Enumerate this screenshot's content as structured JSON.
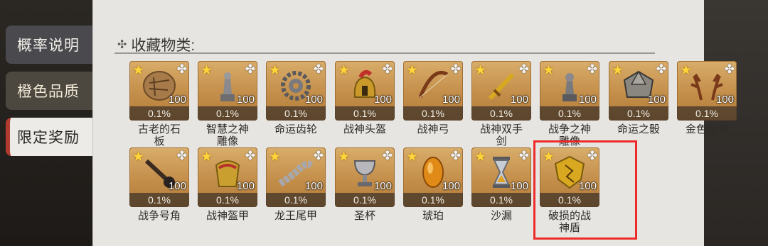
{
  "side_tabs": [
    {
      "label": "概率说明"
    },
    {
      "label": "橙色品质"
    },
    {
      "label": "限定奖励"
    }
  ],
  "section": {
    "deco": "✣",
    "title": "收藏物类:"
  },
  "items": [
    {
      "name": "古老的石板",
      "prob": "0.1%",
      "count": "100",
      "icon": "stone-tablet-icon"
    },
    {
      "name": "智慧之神雕像",
      "prob": "0.1%",
      "count": "100",
      "icon": "wisdom-statue-icon"
    },
    {
      "name": "命运齿轮",
      "prob": "0.1%",
      "count": "100",
      "icon": "gear-icon"
    },
    {
      "name": "战神头盔",
      "prob": "0.1%",
      "count": "100",
      "icon": "helmet-icon"
    },
    {
      "name": "战神弓",
      "prob": "0.1%",
      "count": "100",
      "icon": "bow-icon"
    },
    {
      "name": "战神双手剑",
      "prob": "0.1%",
      "count": "100",
      "icon": "sword-icon"
    },
    {
      "name": "战争之神雕像",
      "prob": "0.1%",
      "count": "100",
      "icon": "war-statue-icon"
    },
    {
      "name": "命运之骰",
      "prob": "0.1%",
      "count": "100",
      "icon": "dice-icon"
    },
    {
      "name": "金色鹿角",
      "prob": "0.1%",
      "count": "100",
      "icon": "antler-icon"
    },
    {
      "name": "战争号角",
      "prob": "0.1%",
      "count": "100",
      "icon": "horn-icon"
    },
    {
      "name": "战神盔甲",
      "prob": "0.1%",
      "count": "100",
      "icon": "armor-icon"
    },
    {
      "name": "龙王尾甲",
      "prob": "0.1%",
      "count": "100",
      "icon": "tail-armor-icon"
    },
    {
      "name": "圣杯",
      "prob": "0.1%",
      "count": "100",
      "icon": "grail-icon"
    },
    {
      "name": "琥珀",
      "prob": "0.1%",
      "count": "100",
      "icon": "amber-icon"
    },
    {
      "name": "沙漏",
      "prob": "0.1%",
      "count": "100",
      "icon": "hourglass-icon"
    },
    {
      "name": "破损的战神盾",
      "prob": "0.1%",
      "count": "100",
      "icon": "shield-icon"
    }
  ],
  "colors": {
    "highlight": "#ee2b2b",
    "card": "#c38e4a",
    "star": "#ffd53a"
  }
}
